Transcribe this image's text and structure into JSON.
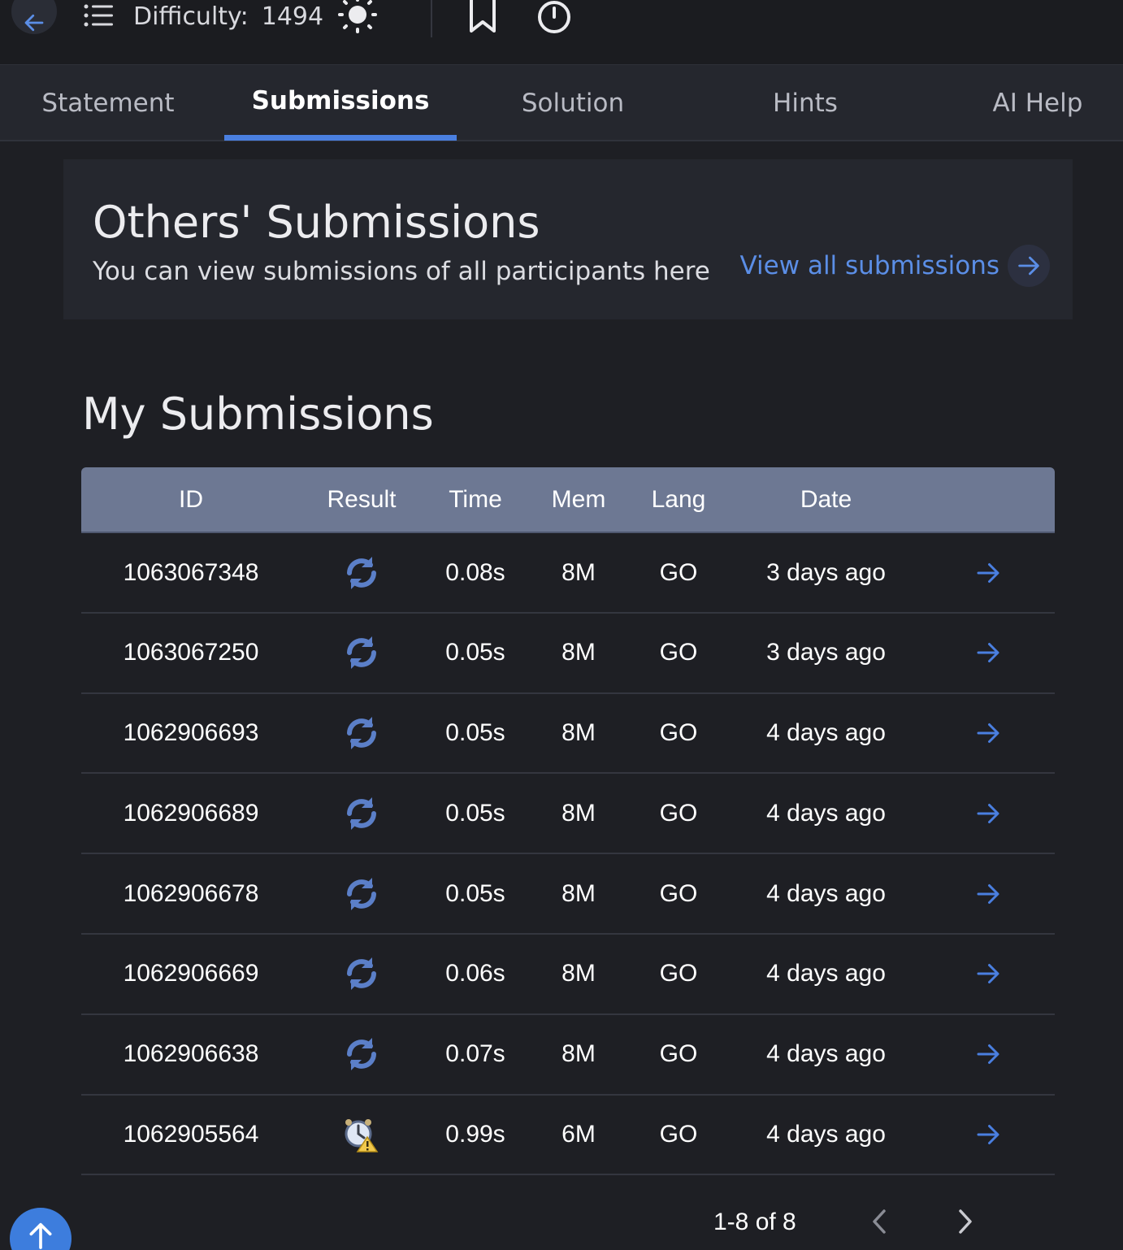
{
  "toolbar": {
    "difficulty_label": "Difficulty:",
    "difficulty_value": "1494",
    "icons": [
      "arrow-left-icon",
      "list-icon",
      "sun-icon",
      "bookmark-icon",
      "timer-icon"
    ]
  },
  "tabs": [
    {
      "label": "Statement",
      "active": false
    },
    {
      "label": "Submissions",
      "active": true
    },
    {
      "label": "Solution",
      "active": false
    },
    {
      "label": "Hints",
      "active": false
    },
    {
      "label": "AI Help",
      "active": false
    }
  ],
  "others": {
    "title": "Others' Submissions",
    "subtitle": "You can view submissions of all participants here",
    "view_all": "View all submissions"
  },
  "my": {
    "title": "My Submissions",
    "columns": [
      "ID",
      "Result",
      "Time",
      "Mem",
      "Lang",
      "Date"
    ],
    "rows": [
      {
        "id": "1063067348",
        "result": "refresh-icon",
        "time": "0.08s",
        "mem": "8M",
        "lang": "GO",
        "date": "3 days ago"
      },
      {
        "id": "1063067250",
        "result": "refresh-icon",
        "time": "0.05s",
        "mem": "8M",
        "lang": "GO",
        "date": "3 days ago"
      },
      {
        "id": "1062906693",
        "result": "refresh-icon",
        "time": "0.05s",
        "mem": "8M",
        "lang": "GO",
        "date": "4 days ago"
      },
      {
        "id": "1062906689",
        "result": "refresh-icon",
        "time": "0.05s",
        "mem": "8M",
        "lang": "GO",
        "date": "4 days ago"
      },
      {
        "id": "1062906678",
        "result": "refresh-icon",
        "time": "0.05s",
        "mem": "8M",
        "lang": "GO",
        "date": "4 days ago"
      },
      {
        "id": "1062906669",
        "result": "refresh-icon",
        "time": "0.06s",
        "mem": "8M",
        "lang": "GO",
        "date": "4 days ago"
      },
      {
        "id": "1062906638",
        "result": "refresh-icon",
        "time": "0.07s",
        "mem": "8M",
        "lang": "GO",
        "date": "4 days ago"
      },
      {
        "id": "1062905564",
        "result": "alarm-clock-warning-icon",
        "time": "0.99s",
        "mem": "6M",
        "lang": "GO",
        "date": "4 days ago"
      }
    ]
  },
  "pagination": {
    "label": "1-8 of 8"
  },
  "colors": {
    "background": "#1e1f24",
    "accent": "#4a7fe0",
    "link": "#5b8ee6",
    "table_header": "#6d7893"
  }
}
